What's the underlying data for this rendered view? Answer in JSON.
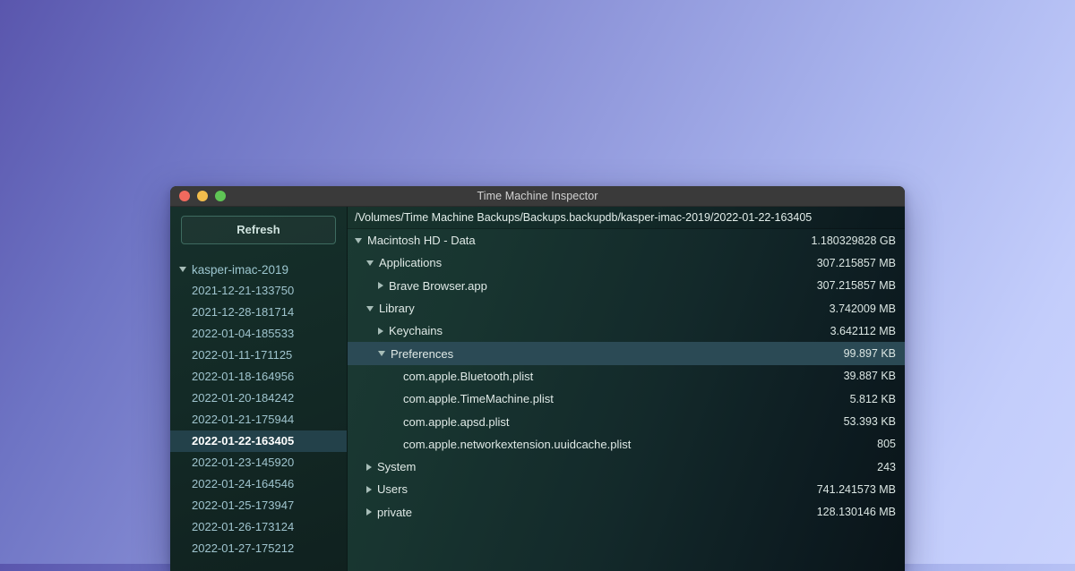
{
  "window": {
    "title": "Time Machine Inspector",
    "traffic_lights": [
      {
        "name": "close-button",
        "color": "#ef6a5e"
      },
      {
        "name": "minimize-button",
        "color": "#f2bd4c"
      },
      {
        "name": "maximize-button",
        "color": "#5fc555"
      }
    ]
  },
  "sidebar": {
    "refresh_label": "Refresh",
    "machine": "kasper-imac-2019",
    "machine_expanded": true,
    "snapshots": [
      {
        "label": "2021-12-21-133750",
        "selected": false
      },
      {
        "label": "2021-12-28-181714",
        "selected": false
      },
      {
        "label": "2022-01-04-185533",
        "selected": false
      },
      {
        "label": "2022-01-11-171125",
        "selected": false
      },
      {
        "label": "2022-01-18-164956",
        "selected": false
      },
      {
        "label": "2022-01-20-184242",
        "selected": false
      },
      {
        "label": "2022-01-21-175944",
        "selected": false
      },
      {
        "label": "2022-01-22-163405",
        "selected": true
      },
      {
        "label": "2022-01-23-145920",
        "selected": false
      },
      {
        "label": "2022-01-24-164546",
        "selected": false
      },
      {
        "label": "2022-01-25-173947",
        "selected": false
      },
      {
        "label": "2022-01-26-173124",
        "selected": false
      },
      {
        "label": "2022-01-27-175212",
        "selected": false
      }
    ]
  },
  "main": {
    "path": "/Volumes/Time Machine Backups/Backups.backupdb/kasper-imac-2019/2022-01-22-163405",
    "rows": [
      {
        "name": "Macintosh HD - Data",
        "size": "1.180329828 GB",
        "depth": 0,
        "disclosure": "down",
        "selected": false
      },
      {
        "name": "Applications",
        "size": "307.215857 MB",
        "depth": 1,
        "disclosure": "down",
        "selected": false
      },
      {
        "name": "Brave Browser.app",
        "size": "307.215857 MB",
        "depth": 2,
        "disclosure": "right",
        "selected": false
      },
      {
        "name": "Library",
        "size": "3.742009 MB",
        "depth": 1,
        "disclosure": "down",
        "selected": false
      },
      {
        "name": "Keychains",
        "size": "3.642112 MB",
        "depth": 2,
        "disclosure": "right",
        "selected": false
      },
      {
        "name": "Preferences",
        "size": "99.897 KB",
        "depth": 2,
        "disclosure": "down",
        "selected": true
      },
      {
        "name": "com.apple.Bluetooth.plist",
        "size": "39.887 KB",
        "depth": 3,
        "disclosure": "none",
        "selected": false
      },
      {
        "name": "com.apple.TimeMachine.plist",
        "size": "5.812 KB",
        "depth": 3,
        "disclosure": "none",
        "selected": false
      },
      {
        "name": "com.apple.apsd.plist",
        "size": "53.393 KB",
        "depth": 3,
        "disclosure": "none",
        "selected": false
      },
      {
        "name": "com.apple.networkextension.uuidcache.plist",
        "size": "805",
        "depth": 3,
        "disclosure": "none",
        "selected": false
      },
      {
        "name": "System",
        "size": "243",
        "depth": 1,
        "disclosure": "right",
        "selected": false
      },
      {
        "name": "Users",
        "size": "741.241573 MB",
        "depth": 1,
        "disclosure": "right",
        "selected": false
      },
      {
        "name": "private",
        "size": "128.130146 MB",
        "depth": 1,
        "disclosure": "right",
        "selected": false
      }
    ]
  },
  "colors": {
    "desktop_gradient_start": "#5a56ad",
    "desktop_gradient_end": "#cad3fd",
    "titlebar": "#3a3a3a",
    "sidebar_selection": "#23414a",
    "row_selection": "#2b4a55",
    "accent_text": "#9fc4ce"
  }
}
